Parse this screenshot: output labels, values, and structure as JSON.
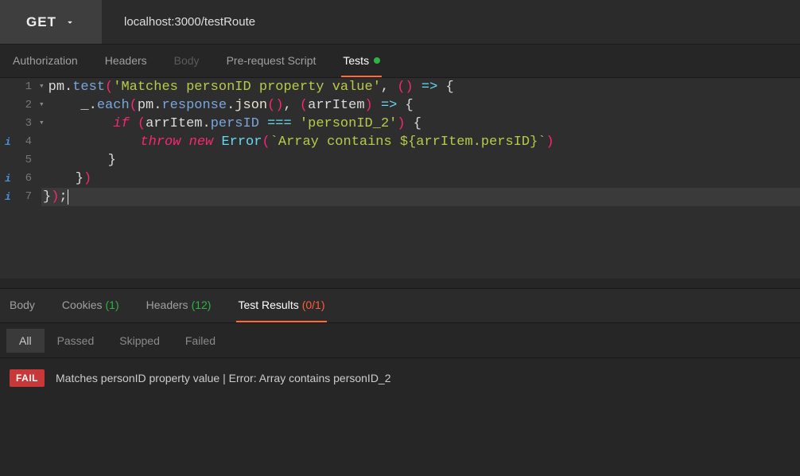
{
  "topbar": {
    "method": "GET",
    "url": "localhost:3000/testRoute"
  },
  "requestTabs": {
    "authorization": "Authorization",
    "headers": "Headers",
    "body": "Body",
    "prerequest": "Pre-request Script",
    "tests": "Tests"
  },
  "code": {
    "lines": [
      {
        "n": "1",
        "fold": true,
        "info": false,
        "tokens": [
          {
            "t": "pm",
            "c": "c-ident"
          },
          {
            "t": ".",
            "c": "c-punc"
          },
          {
            "t": "test",
            "c": "c-prop"
          },
          {
            "t": "(",
            "c": "c-paren"
          },
          {
            "t": "'Matches personID property value'",
            "c": "c-str"
          },
          {
            "t": ", ",
            "c": "c-punc"
          },
          {
            "t": "(",
            "c": "c-paren"
          },
          {
            "t": ")",
            "c": "c-paren"
          },
          {
            "t": " ",
            "c": "c-punc"
          },
          {
            "t": "=>",
            "c": "c-op"
          },
          {
            "t": " {",
            "c": "c-punc"
          }
        ]
      },
      {
        "n": "2",
        "fold": true,
        "info": false,
        "tokens": [
          {
            "t": "    _",
            "c": "c-ident"
          },
          {
            "t": ".",
            "c": "c-punc"
          },
          {
            "t": "each",
            "c": "c-prop"
          },
          {
            "t": "(",
            "c": "c-paren"
          },
          {
            "t": "pm",
            "c": "c-ident"
          },
          {
            "t": ".",
            "c": "c-punc"
          },
          {
            "t": "response",
            "c": "c-prop"
          },
          {
            "t": ".",
            "c": "c-punc"
          },
          {
            "t": "json",
            "c": "c-call"
          },
          {
            "t": "(",
            "c": "c-paren"
          },
          {
            "t": ")",
            "c": "c-paren"
          },
          {
            "t": ", ",
            "c": "c-punc"
          },
          {
            "t": "(",
            "c": "c-paren"
          },
          {
            "t": "arrItem",
            "c": "c-ident"
          },
          {
            "t": ")",
            "c": "c-paren"
          },
          {
            "t": " ",
            "c": "c-punc"
          },
          {
            "t": "=>",
            "c": "c-op"
          },
          {
            "t": " {",
            "c": "c-punc"
          }
        ]
      },
      {
        "n": "3",
        "fold": true,
        "info": false,
        "tokens": [
          {
            "t": "        ",
            "c": "c-punc"
          },
          {
            "t": "if",
            "c": "c-kw"
          },
          {
            "t": " ",
            "c": "c-punc"
          },
          {
            "t": "(",
            "c": "c-paren"
          },
          {
            "t": "arrItem",
            "c": "c-ident"
          },
          {
            "t": ".",
            "c": "c-punc"
          },
          {
            "t": "persID",
            "c": "c-prop"
          },
          {
            "t": " ",
            "c": "c-punc"
          },
          {
            "t": "===",
            "c": "c-op"
          },
          {
            "t": " ",
            "c": "c-punc"
          },
          {
            "t": "'personID_2'",
            "c": "c-str"
          },
          {
            "t": ")",
            "c": "c-paren"
          },
          {
            "t": " {",
            "c": "c-punc"
          }
        ]
      },
      {
        "n": "4",
        "fold": false,
        "info": true,
        "tokens": [
          {
            "t": "            ",
            "c": "c-punc"
          },
          {
            "t": "throw",
            "c": "c-kw"
          },
          {
            "t": " ",
            "c": "c-punc"
          },
          {
            "t": "new",
            "c": "c-kw"
          },
          {
            "t": " ",
            "c": "c-punc"
          },
          {
            "t": "Error",
            "c": "c-class"
          },
          {
            "t": "(",
            "c": "c-paren"
          },
          {
            "t": "`Array contains ${arrItem.persID}`",
            "c": "c-str"
          },
          {
            "t": ")",
            "c": "c-paren"
          }
        ]
      },
      {
        "n": "5",
        "fold": false,
        "info": false,
        "tokens": [
          {
            "t": "        }",
            "c": "c-punc"
          }
        ]
      },
      {
        "n": "6",
        "fold": false,
        "info": true,
        "tokens": [
          {
            "t": "    }",
            "c": "c-punc"
          },
          {
            "t": ")",
            "c": "c-paren"
          }
        ]
      },
      {
        "n": "7",
        "fold": false,
        "info": true,
        "hl": true,
        "tokens": [
          {
            "t": "}",
            "c": "c-punc"
          },
          {
            "t": ")",
            "c": "c-paren"
          },
          {
            "t": ";",
            "c": "c-punc"
          }
        ]
      }
    ]
  },
  "responseTabs": {
    "body": "Body",
    "cookies": "Cookies",
    "cookiesCount": "(1)",
    "headers": "Headers",
    "headersCount": "(12)",
    "testResults": "Test Results",
    "testResultsCount": "(0/1)"
  },
  "filters": {
    "all": "All",
    "passed": "Passed",
    "skipped": "Skipped",
    "failed": "Failed"
  },
  "results": {
    "badge": "FAIL",
    "text": "Matches personID property value | Error: Array contains personID_2"
  }
}
